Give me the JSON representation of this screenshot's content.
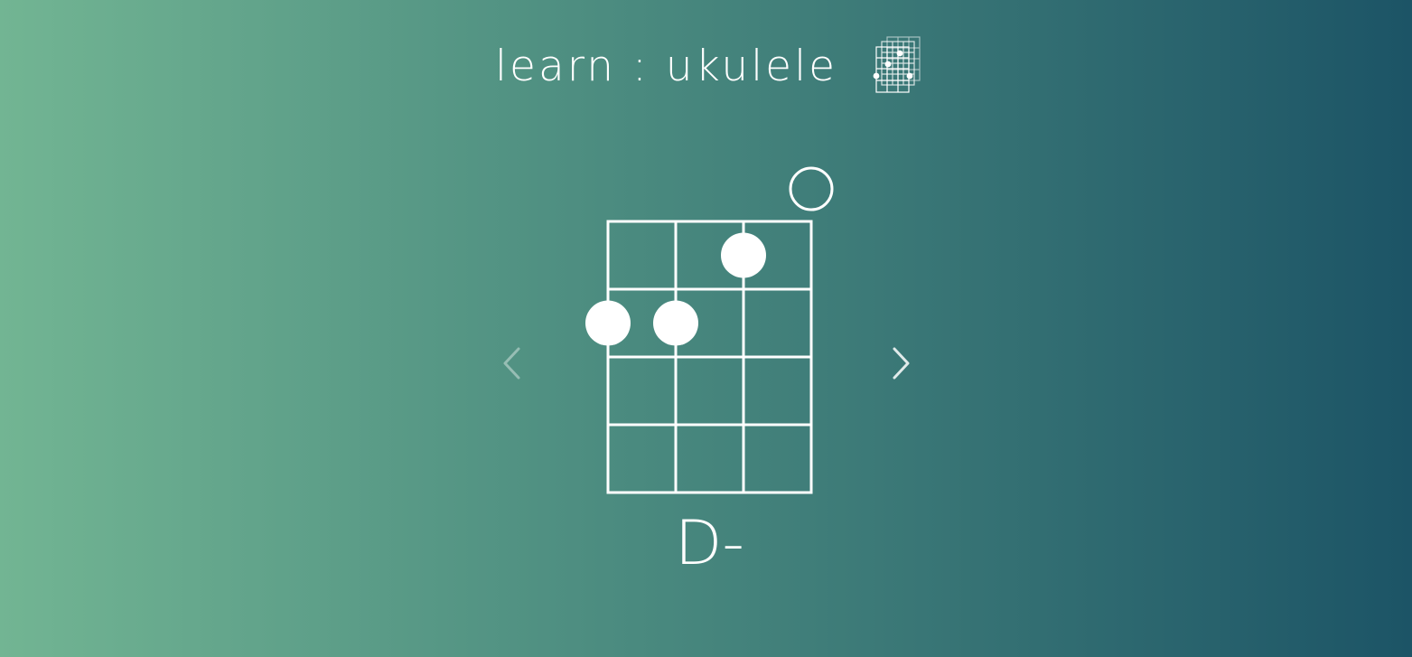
{
  "header": {
    "title": "learn : ukulele",
    "logo_icon": "chord-chart-stack-icon"
  },
  "chord": {
    "name": "D-",
    "strings": 4,
    "frets_shown": 4,
    "open_strings": [
      4
    ],
    "fingers": [
      {
        "string": 1,
        "fret": 2
      },
      {
        "string": 2,
        "fret": 2
      },
      {
        "string": 3,
        "fret": 1
      }
    ]
  },
  "nav": {
    "prev_icon": "chevron-left-icon",
    "next_icon": "chevron-right-icon",
    "prev_enabled": false,
    "next_enabled": true
  },
  "colors": {
    "gradient_start": "#72b593",
    "gradient_end": "#1c5466",
    "foreground": "#ffffff"
  }
}
